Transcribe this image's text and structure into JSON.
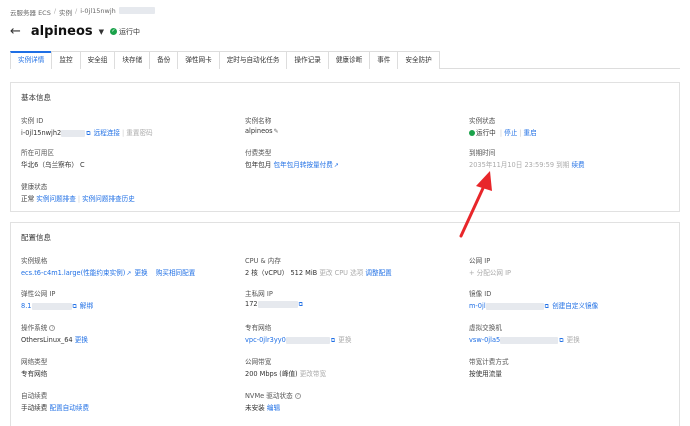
{
  "breadcrumb": {
    "root": "云服务器 ECS",
    "sep": "/",
    "parent": "实例",
    "current": "i-0jl15nwjh"
  },
  "header": {
    "back": "←",
    "title": "alpineos",
    "status": "运行中"
  },
  "tabs": [
    "实例详情",
    "监控",
    "安全组",
    "块存储",
    "备份",
    "弹性网卡",
    "定时与自动化任务",
    "操作记录",
    "健康诊断",
    "事件",
    "安全防护"
  ],
  "basic": {
    "heading": "基本信息",
    "instance_id": {
      "label": "实例 ID",
      "value": "i-0jl15nwjh2",
      "link1": "远程连接",
      "link2": "重置密码"
    },
    "instance_name": {
      "label": "实例名称",
      "value": "alpineos"
    },
    "instance_status": {
      "label": "实例状态",
      "value": "运行中",
      "link1": "停止",
      "link2": "重启"
    },
    "zone": {
      "label": "所在可用区",
      "value": "华北6（乌兰察布） C"
    },
    "billing": {
      "label": "付费类型",
      "value": "包年包月",
      "link": "包年包月转按量付费"
    },
    "expire": {
      "label": "到期时间",
      "value": "2035年11月10日 23:59:59",
      "suffix": "到期",
      "link": "续费"
    },
    "health": {
      "label": "健康状态",
      "value": "正常",
      "link1": "实例问题排查",
      "link2": "实例问题排查历史"
    }
  },
  "config": {
    "heading": "配置信息",
    "spec": {
      "label": "实例规格",
      "value": "ecs.t6-c4m1.large(性能约束实例)",
      "link1": "更换",
      "link2": "购买相同配置"
    },
    "cpu": {
      "label": "CPU & 内存",
      "value": "2 核（vCPU） 512 MiB",
      "muted": "更改 CPU 选项",
      "link": "调整配置"
    },
    "public_ip": {
      "label": "公网 IP",
      "value": "+ 分配公网 IP"
    },
    "eip": {
      "label": "弹性公网 IP",
      "value": "8.1",
      "link": "解绑"
    },
    "private_ip": {
      "label": "主私网 IP",
      "value": "172"
    },
    "image": {
      "label": "镜像 ID",
      "value": "m-0jl",
      "link": "创建自定义镜像"
    },
    "os": {
      "label": "操作系统",
      "value": "OthersLinux_64",
      "link": "更换"
    },
    "vpc": {
      "label": "专有网络",
      "value": "vpc-0jlr3yy0",
      "muted": "更换"
    },
    "vswitch": {
      "label": "虚拟交换机",
      "value": "vsw-0jla5",
      "muted": "更换"
    },
    "net_type": {
      "label": "网络类型",
      "value": "专有网络"
    },
    "bandwidth": {
      "label": "公网带宽",
      "value": "200 Mbps (峰值)",
      "muted": "更改带宽"
    },
    "bw_billing": {
      "label": "带宽计费方式",
      "value": "按使用流量"
    },
    "auto_renew": {
      "label": "自动续费",
      "value": "手动续费",
      "link": "配置自动续费"
    },
    "nvme": {
      "label": "NVMe 驱动状态",
      "value": "未安装",
      "link": "编辑"
    }
  },
  "colors": {
    "accent": "#1f6fe5",
    "ok": "#1aa24a",
    "arrow": "#e8262a"
  }
}
